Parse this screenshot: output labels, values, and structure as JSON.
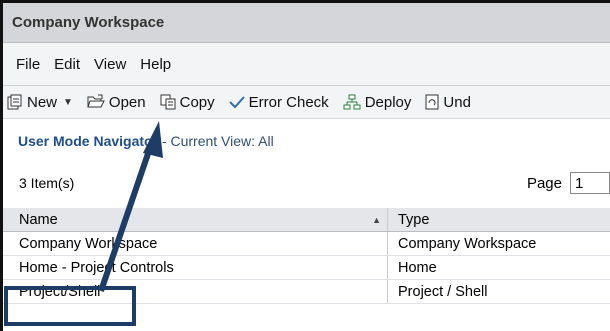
{
  "window": {
    "title": "Company Workspace"
  },
  "menu": [
    "File",
    "Edit",
    "View",
    "Help"
  ],
  "toolbar": {
    "new": "New",
    "open": "Open",
    "copy": "Copy",
    "error_check": "Error Check",
    "deploy": "Deploy",
    "undo": "Und"
  },
  "navigator": {
    "title": "User Mode Navigator",
    "view_label": "- Current View: All"
  },
  "list": {
    "count": "3  Item(s)",
    "page_label": "Page",
    "page_value": "1",
    "columns": {
      "name": "Name",
      "type": "Type"
    },
    "rows": [
      {
        "name": "Company Workspace",
        "type": "Company Workspace"
      },
      {
        "name": "Home - Project Controls",
        "type": "Home"
      },
      {
        "name": "Project/Shell",
        "type": "Project / Shell"
      }
    ]
  },
  "colors": {
    "annotation": "#1d3c66",
    "nav_title": "#1f4e8c"
  }
}
